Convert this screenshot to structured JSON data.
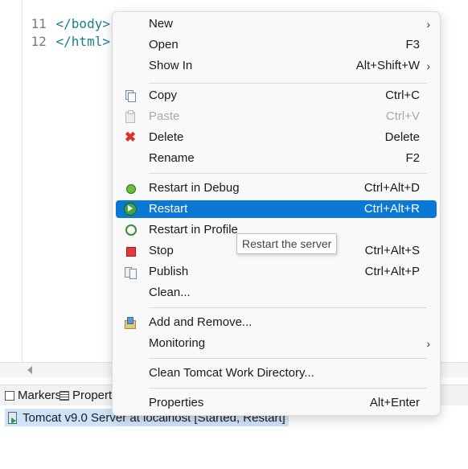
{
  "editor": {
    "lines": [
      {
        "num": "11",
        "code": "</body>"
      },
      {
        "num": "12",
        "code": "</html>"
      }
    ]
  },
  "views": {
    "tabs": [
      {
        "label": "Markers",
        "icon": "markers-icon"
      },
      {
        "label": "Propert",
        "icon": "properties-icon"
      }
    ],
    "server_row": "Tomcat v9.0 Server at localhost  [Started, Restart]"
  },
  "context_menu": {
    "items": [
      {
        "label": "New",
        "shortcut": "",
        "submenu": true
      },
      {
        "label": "Open",
        "shortcut": "F3"
      },
      {
        "label": "Show In",
        "shortcut": "Alt+Shift+W",
        "submenu": true
      },
      {
        "label": "Copy",
        "shortcut": "Ctrl+C",
        "icon": "copy-icon"
      },
      {
        "label": "Paste",
        "shortcut": "Ctrl+V",
        "icon": "paste-icon",
        "disabled": true
      },
      {
        "label": "Delete",
        "shortcut": "Delete",
        "icon": "delete-icon"
      },
      {
        "label": "Rename",
        "shortcut": "F2"
      },
      {
        "label": "Restart in Debug",
        "shortcut": "Ctrl+Alt+D",
        "icon": "debug-icon"
      },
      {
        "label": "Restart",
        "shortcut": "Ctrl+Alt+R",
        "icon": "restart-icon",
        "selected": true
      },
      {
        "label": "Restart in Profile",
        "shortcut": "",
        "icon": "profile-icon"
      },
      {
        "label": "Stop",
        "shortcut": "Ctrl+Alt+S",
        "icon": "stop-icon"
      },
      {
        "label": "Publish",
        "shortcut": "Ctrl+Alt+P",
        "icon": "publish-icon"
      },
      {
        "label": "Clean...",
        "shortcut": ""
      },
      {
        "label": "Add and Remove...",
        "shortcut": "",
        "icon": "add-remove-icon"
      },
      {
        "label": "Monitoring",
        "shortcut": "",
        "submenu": true
      },
      {
        "label": "Clean Tomcat Work Directory...",
        "shortcut": ""
      },
      {
        "label": "Properties",
        "shortcut": "Alt+Enter"
      }
    ],
    "submenu_glyph": "›"
  },
  "tooltip": "Restart the server",
  "colors": {
    "selection": "#0b78d6",
    "code_tag": "#17808a",
    "server_row_bg": "#cfe3f8"
  }
}
